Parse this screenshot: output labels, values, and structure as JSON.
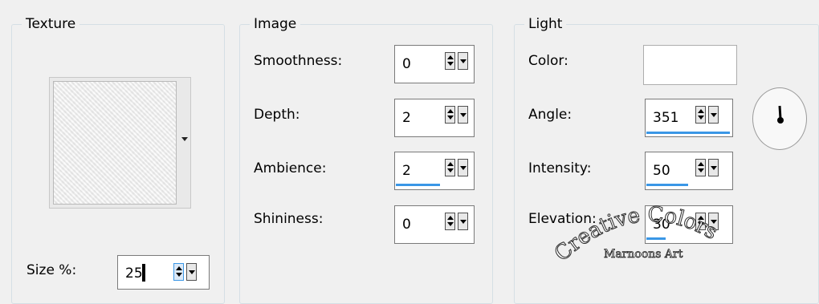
{
  "texture": {
    "legend": "Texture",
    "size_label": "Size %:",
    "size_value": "25"
  },
  "image": {
    "legend": "Image",
    "smoothness_label": "Smoothness:",
    "smoothness_value": "0",
    "depth_label": "Depth:",
    "depth_value": "2",
    "ambience_label": "Ambience:",
    "ambience_value": "2",
    "shininess_label": "Shininess:",
    "shininess_value": "0"
  },
  "light": {
    "legend": "Light",
    "color_label": "Color:",
    "color_value": "#ffffff",
    "angle_label": "Angle:",
    "angle_value": "351",
    "intensity_label": "Intensity:",
    "intensity_value": "50",
    "elevation_label": "Elevation:",
    "elevation_value": "30"
  },
  "watermark": {
    "line1": "Creative Colors",
    "line2": "Marnoons Art"
  },
  "colors": {
    "accent_bar": "#3a97e6",
    "background": "#f0f0f0"
  }
}
